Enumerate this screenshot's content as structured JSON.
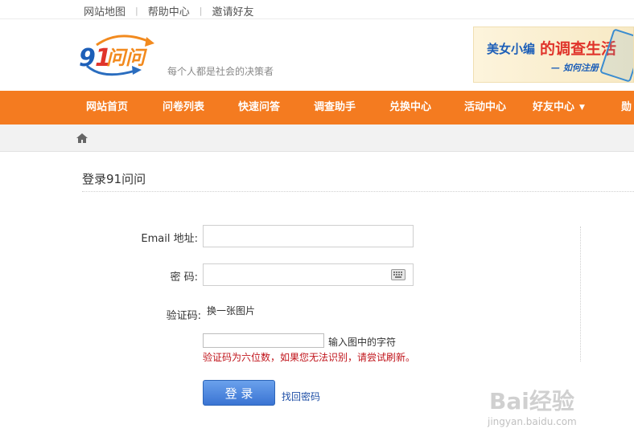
{
  "topbar": {
    "links": [
      "网站地图",
      "帮助中心",
      "邀请好友"
    ],
    "separator": "|"
  },
  "header": {
    "logo_text": "91问问",
    "slogan": "每个人都是社会的决策者",
    "banner": {
      "line1": "美女小编",
      "line2": "的调查生活",
      "line3": "— 如何注册"
    }
  },
  "nav": {
    "items": [
      "网站首页",
      "问卷列表",
      "快速问答",
      "调查助手",
      "兑换中心",
      "活动中心",
      "好友中心",
      "勋"
    ]
  },
  "page": {
    "title": "登录91问问"
  },
  "form": {
    "email_label": "Email 地址:",
    "email_value": "",
    "password_label": "密 码:",
    "password_value": "",
    "captcha_label": "验证码:",
    "captcha_refresh": "换一张图片",
    "captcha_value": "",
    "captcha_hint": "输入图中的字符",
    "captcha_warning": "验证码为六位数，如果您无法识别，请尝试刷新。",
    "login_button": "登 录",
    "forgot_link": "找回密码"
  },
  "watermark": {
    "brand": "Bai经验",
    "url": "jingyan.baidu.com"
  },
  "colors": {
    "nav_bg": "#f47b20",
    "button_blue": "#3a74d3",
    "warning_red": "#c0141b",
    "link_blue": "#1f4fa6"
  }
}
